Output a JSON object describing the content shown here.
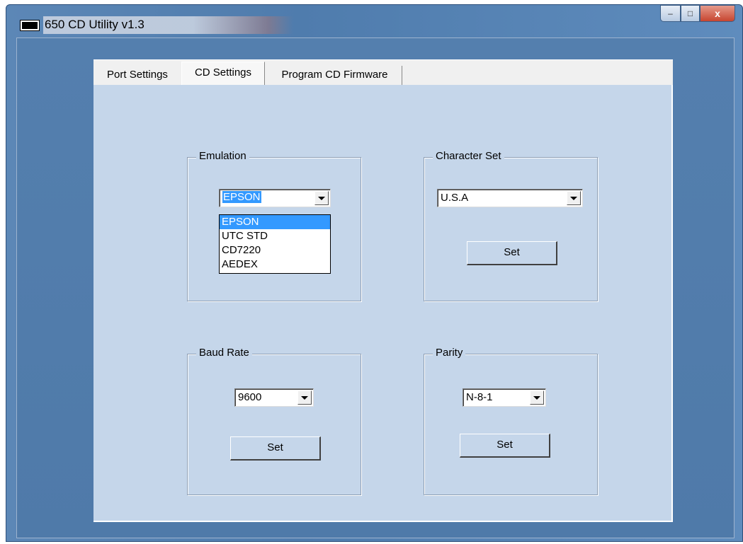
{
  "window": {
    "title": "650 CD Utility v1.3",
    "close_glyph": "x",
    "minimize_glyph": "–",
    "maximize_glyph": "□"
  },
  "tabs": [
    {
      "label": "Port Settings",
      "active": false
    },
    {
      "label": "CD Settings",
      "active": true
    },
    {
      "label": "Program CD Firmware",
      "active": false
    }
  ],
  "emulation": {
    "group_label": "Emulation",
    "selected": "EPSON",
    "options": [
      "EPSON",
      "UTC STD",
      "CD7220",
      "AEDEX"
    ],
    "dropdown_open": true
  },
  "character_set": {
    "group_label": "Character Set",
    "selected": "U.S.A",
    "set_label": "Set"
  },
  "baud_rate": {
    "group_label": "Baud Rate",
    "selected": "9600",
    "set_label": "Set"
  },
  "parity": {
    "group_label": "Parity",
    "selected": "N-8-1",
    "set_label": "Set"
  },
  "colors": {
    "selection": "#3399ff",
    "panel": "#c5d6ea",
    "window_frame": "#5c87b6"
  }
}
